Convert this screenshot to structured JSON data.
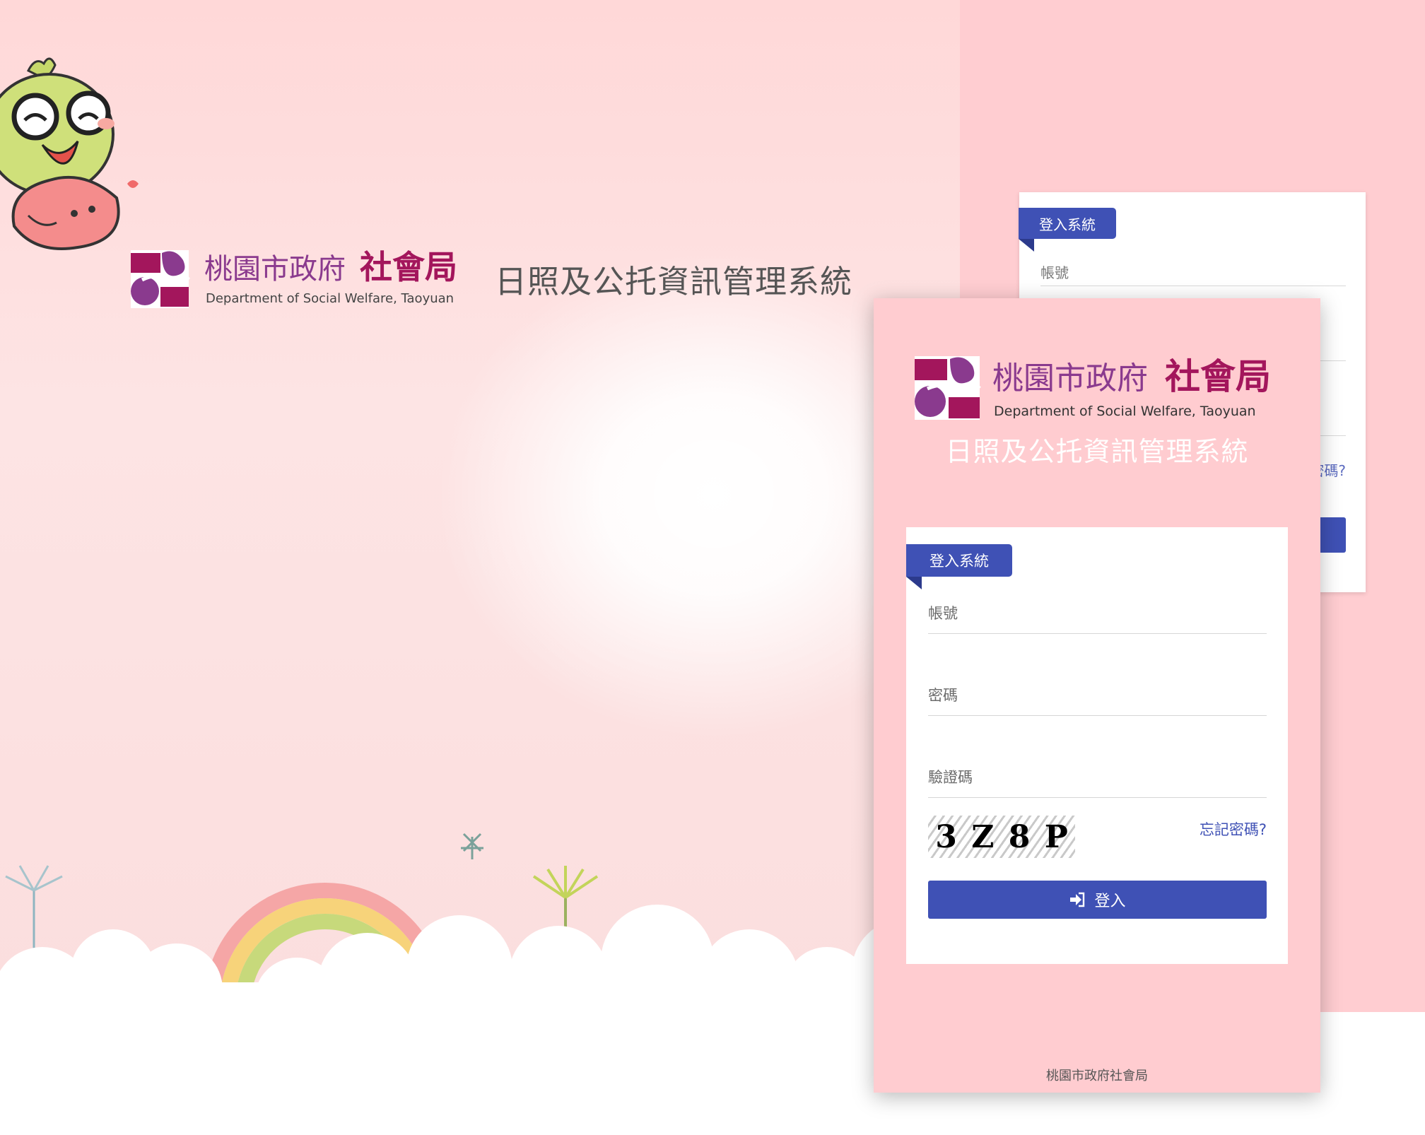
{
  "colors": {
    "accent": "#3f51b5",
    "panel_pink": "#ffccd0",
    "logo_purple": "#8a3a8e",
    "logo_magenta": "#a3165c"
  },
  "logo": {
    "name_zh_a": "桃園市政府",
    "name_zh_b": "社會局",
    "name_en": "Department of Social Welfare, Taoyuan"
  },
  "system_title": "日照及公托資訊管理系統",
  "login": {
    "ribbon": "登入系統",
    "account_label": "帳號",
    "password_label": "密碼",
    "captcha_label": "驗證碼",
    "captcha_chars": [
      "3",
      "Z",
      "8",
      "P"
    ],
    "forgot": "忘記密碼?",
    "back_forgot_partial": "密碼?",
    "submit": "登入",
    "submit_icon": "sign-in-icon"
  },
  "footer": "桃園市政府社會局"
}
